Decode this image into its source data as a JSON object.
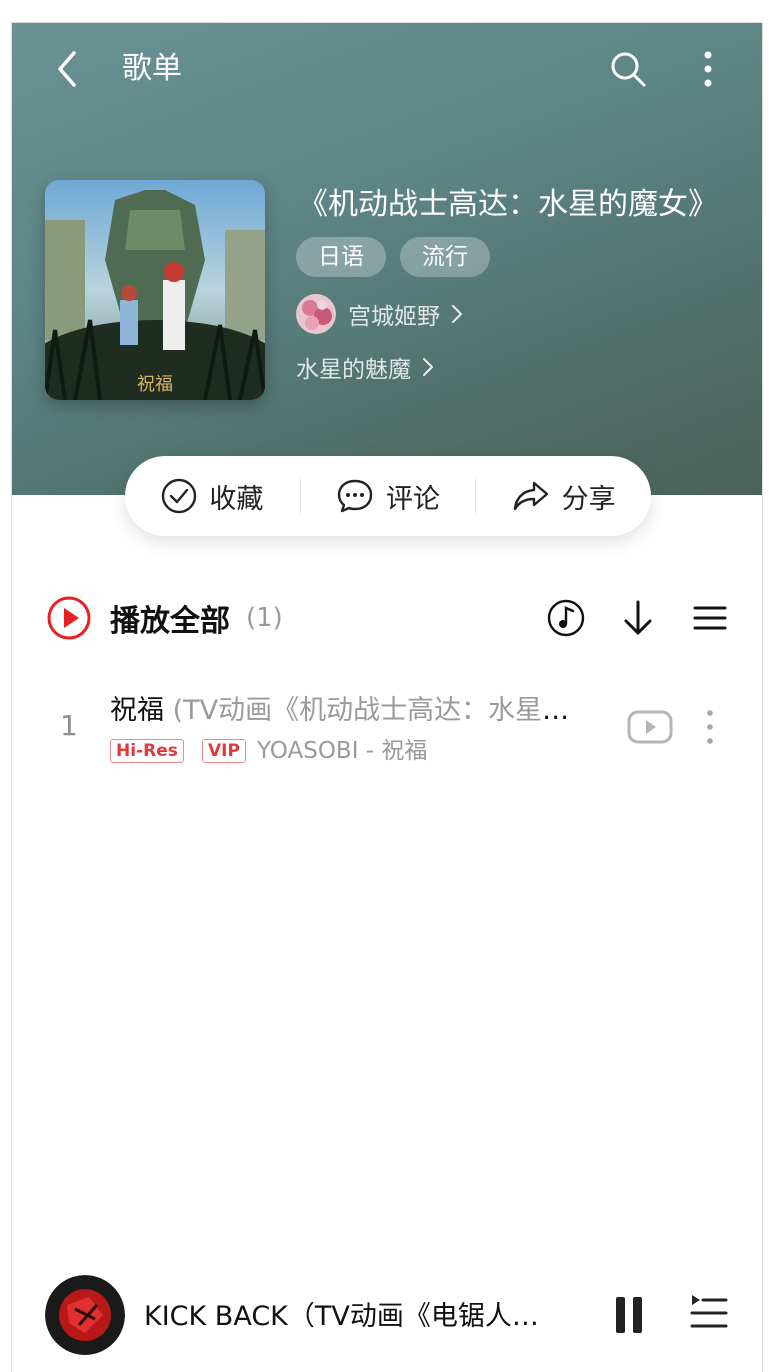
{
  "header": {
    "title": "歌单"
  },
  "playlist": {
    "title": "《机动战士高达：水星的魔女》",
    "tags": [
      "日语",
      "流行"
    ],
    "creator": "宫城姬野",
    "album": "水星的魅魔",
    "cover_text": "祝福"
  },
  "actions": {
    "collect": "收藏",
    "comment": "评论",
    "share": "分享"
  },
  "list": {
    "play_all": "播放全部",
    "count": "(1)"
  },
  "songs": [
    {
      "index": "1",
      "title": "祝福",
      "subtitle": " (TV动画《机动战士高达：水星的魔女》片头曲)",
      "badges": [
        "Hi-Res",
        "VIP"
      ],
      "artist": "YOASOBI - 祝福"
    }
  ],
  "now_playing": {
    "title": "KICK BACK（TV动画《电锯人》片头曲）"
  },
  "colors": {
    "accent": "#e8201f",
    "hero": "#5d8585"
  }
}
